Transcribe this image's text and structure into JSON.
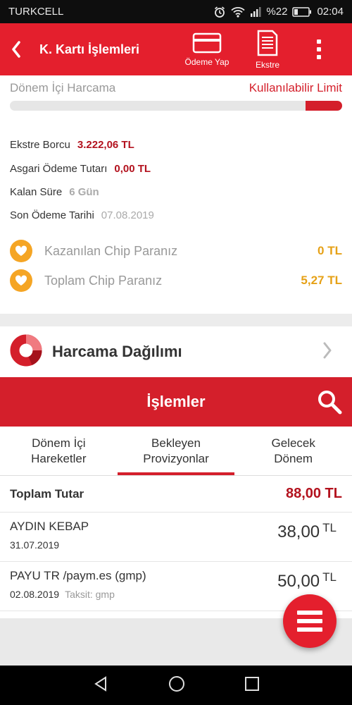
{
  "status_bar": {
    "carrier": "TURKCELL",
    "battery": "%22",
    "time": "02:04"
  },
  "app_bar": {
    "title": "K. Kartı İşlemleri",
    "payment_label": "Ödeme Yap",
    "statement_label": "Ekstre"
  },
  "summary": {
    "period_spending_label": "Dönem İçi Harcama",
    "available_limit_label": "Kullanılabilir Limit",
    "limit_bar_fill_fraction": 0.11,
    "statement_debt_label": "Ekstre Borcu",
    "statement_debt_value": "3.222,06 TL",
    "min_payment_label": "Asgari Ödeme Tutarı",
    "min_payment_value": "0,00 TL",
    "remaining_label": "Kalan Süre",
    "remaining_value": "6 Gün",
    "due_date_label": "Son Ödeme Tarihi",
    "due_date_value": "07.08.2019",
    "chip_earned_label": "Kazanılan Chip Paranız",
    "chip_earned_value": "0 TL",
    "chip_total_label": "Toplam Chip Paranız",
    "chip_total_value": "5,27 TL"
  },
  "distribution": {
    "title": "Harcama Dağılımı"
  },
  "transactions": {
    "title": "İşlemler",
    "tabs": [
      {
        "label": "Dönem İçi\nHareketler"
      },
      {
        "label": "Bekleyen\nProvizyonlar"
      },
      {
        "label": "Gelecek\nDönem"
      }
    ],
    "total_label": "Toplam Tutar",
    "total_value": "88,00 TL",
    "items": [
      {
        "merchant": "AYDIN KEBAP",
        "date": "31.07.2019",
        "installment": "",
        "amount": "38,00",
        "currency": "TL"
      },
      {
        "merchant": "PAYU TR /paym.es (gmp)",
        "date": "02.08.2019",
        "installment": "Taksit: gmp",
        "amount": "50,00",
        "currency": "TL"
      }
    ]
  },
  "colors": {
    "primary_red": "#e41f2d",
    "dark_red": "#b3121e",
    "chip_gold": "#f5a524"
  }
}
